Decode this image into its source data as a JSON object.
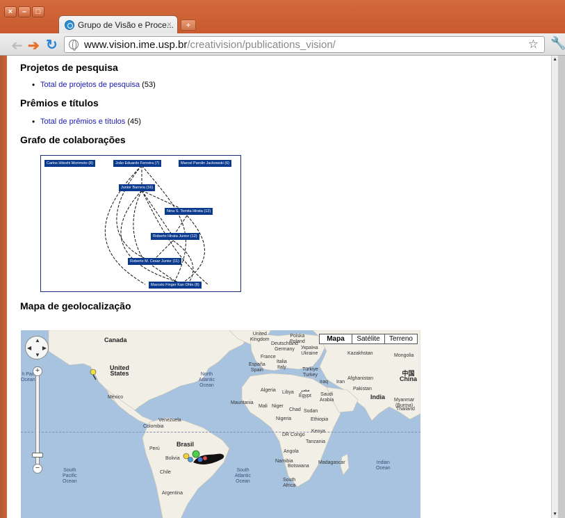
{
  "browser": {
    "tab_title": "Grupo de Visão e Proce...",
    "tab_close": "×",
    "new_tab": "+",
    "url_host": "www.vision.ime.usp.br",
    "url_path": "/creativision/publications_vision/"
  },
  "page": {
    "sections": [
      {
        "heading": "Projetos de pesquisa",
        "link": "Total de projetos de pesquisa",
        "count": " (53)"
      },
      {
        "heading": "Prêmios e títulos",
        "link": "Total de prêmios e títulos",
        "count": " (45)"
      },
      {
        "heading": "Grafo de colaborações"
      },
      {
        "heading": "Mapa de geolocalização"
      }
    ],
    "graph_nodes": [
      "Carlos Hitoshi Morimoto (8)",
      "João Eduardo Ferreira (7)",
      "Marcel Parolin Jackowski (6)",
      "Junior Barrera (16)",
      "Nina S. Tomita Hirata (12)",
      "Roberto Hirata Junior (12)",
      "Roberto M. Cesar Junior (11)",
      "Marcelo Finger Kan Ohto (8)"
    ]
  },
  "map": {
    "types": [
      "Mapa",
      "Satélite",
      "Terreno"
    ],
    "active_type": "Mapa",
    "labels": {
      "canada": "Canada",
      "usa": "United\nStates",
      "mexico": "México",
      "venezuela": "Venezuela",
      "colombia": "Colombia",
      "peru": "Perú",
      "brasil": "Brasil",
      "bolivia": "Bolivia",
      "chile": "Chile",
      "argentina": "Argentina",
      "north_atlantic": "North\nAtlantic\nOcean",
      "south_atlantic": "South\nAtlantic\nOcean",
      "south_pacific": "South\nPacific\nOcean",
      "north_pacific": "h Pac\nOcean",
      "uk": "United\nKingdom",
      "deutschland": "Deutschland\nGermany",
      "france": "France",
      "espana": "España\nSpain",
      "italia": "Italia\nItaly",
      "polska": "Polska\nPoland",
      "ukraine": "Україна\nUkraine",
      "kazakhstan": "Kazakhstan",
      "mongolia": "Mongolia",
      "china": "中国\nChina",
      "turkiye": "Türkiye\nTurkey",
      "iraq": "Iraq",
      "iran": "Iran",
      "afghanistan": "Afghanistan",
      "pakistan": "Pakistan",
      "india": "India",
      "algeria": "Algeria",
      "libya": "Libya",
      "egypt": "مصر\nEgypt",
      "saudi": "Saudi\nArabia",
      "mauritania": "Mauritania",
      "mali": "Mali",
      "niger": "Niger",
      "chad": "Chad",
      "sudan": "Sudan",
      "nigeria": "Nigeria",
      "ethiopia": "Ethiopia",
      "drcongo": "DR Congo",
      "kenya": "Kenya",
      "tanzania": "Tanzania",
      "angola": "Angola",
      "namibia": "Namibia",
      "botswana": "Botswana",
      "madagascar": "Madagascar",
      "south_africa": "South\nAfrica",
      "indian_ocean": "Indian\nOcean",
      "thailand": "Thailand",
      "myanmar": "Myanmar\n(Burma)"
    }
  }
}
